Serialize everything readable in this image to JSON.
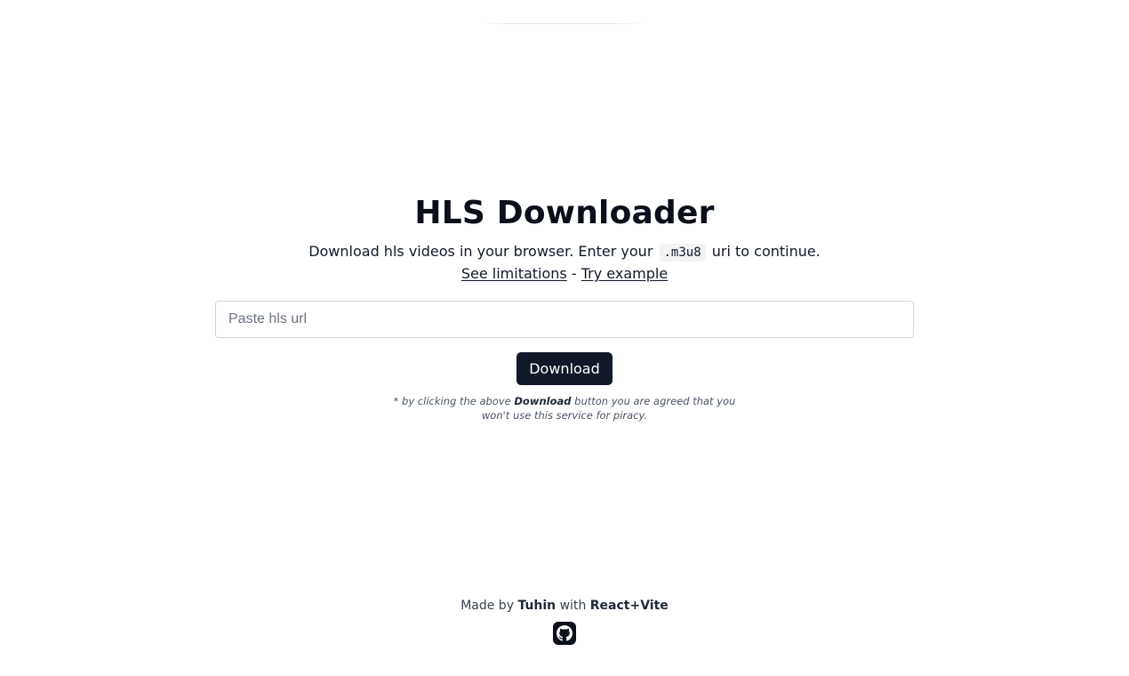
{
  "header": {
    "title": "HLS Downloader"
  },
  "intro": {
    "text_before": "Download hls videos in your browser. Enter your",
    "code": ".m3u8",
    "text_after": "uri to continue.",
    "limitations_link": "See limitations",
    "separator": "-",
    "example_link": "Try example"
  },
  "form": {
    "url_placeholder": "Paste hls url",
    "url_value": "",
    "download_label": "Download"
  },
  "disclaimer": {
    "prefix": "* by clicking the above",
    "button_name": "Download",
    "suffix": "button you are agreed that you won't use this service for piracy."
  },
  "footer": {
    "made_by": "Made by",
    "author": "Tuhin",
    "with": "with",
    "stack": "React+Vite",
    "github_icon": "github-icon"
  },
  "colors": {
    "primary": "#111827",
    "border": "#d1d5db",
    "code_bg": "#f3f4f6"
  }
}
